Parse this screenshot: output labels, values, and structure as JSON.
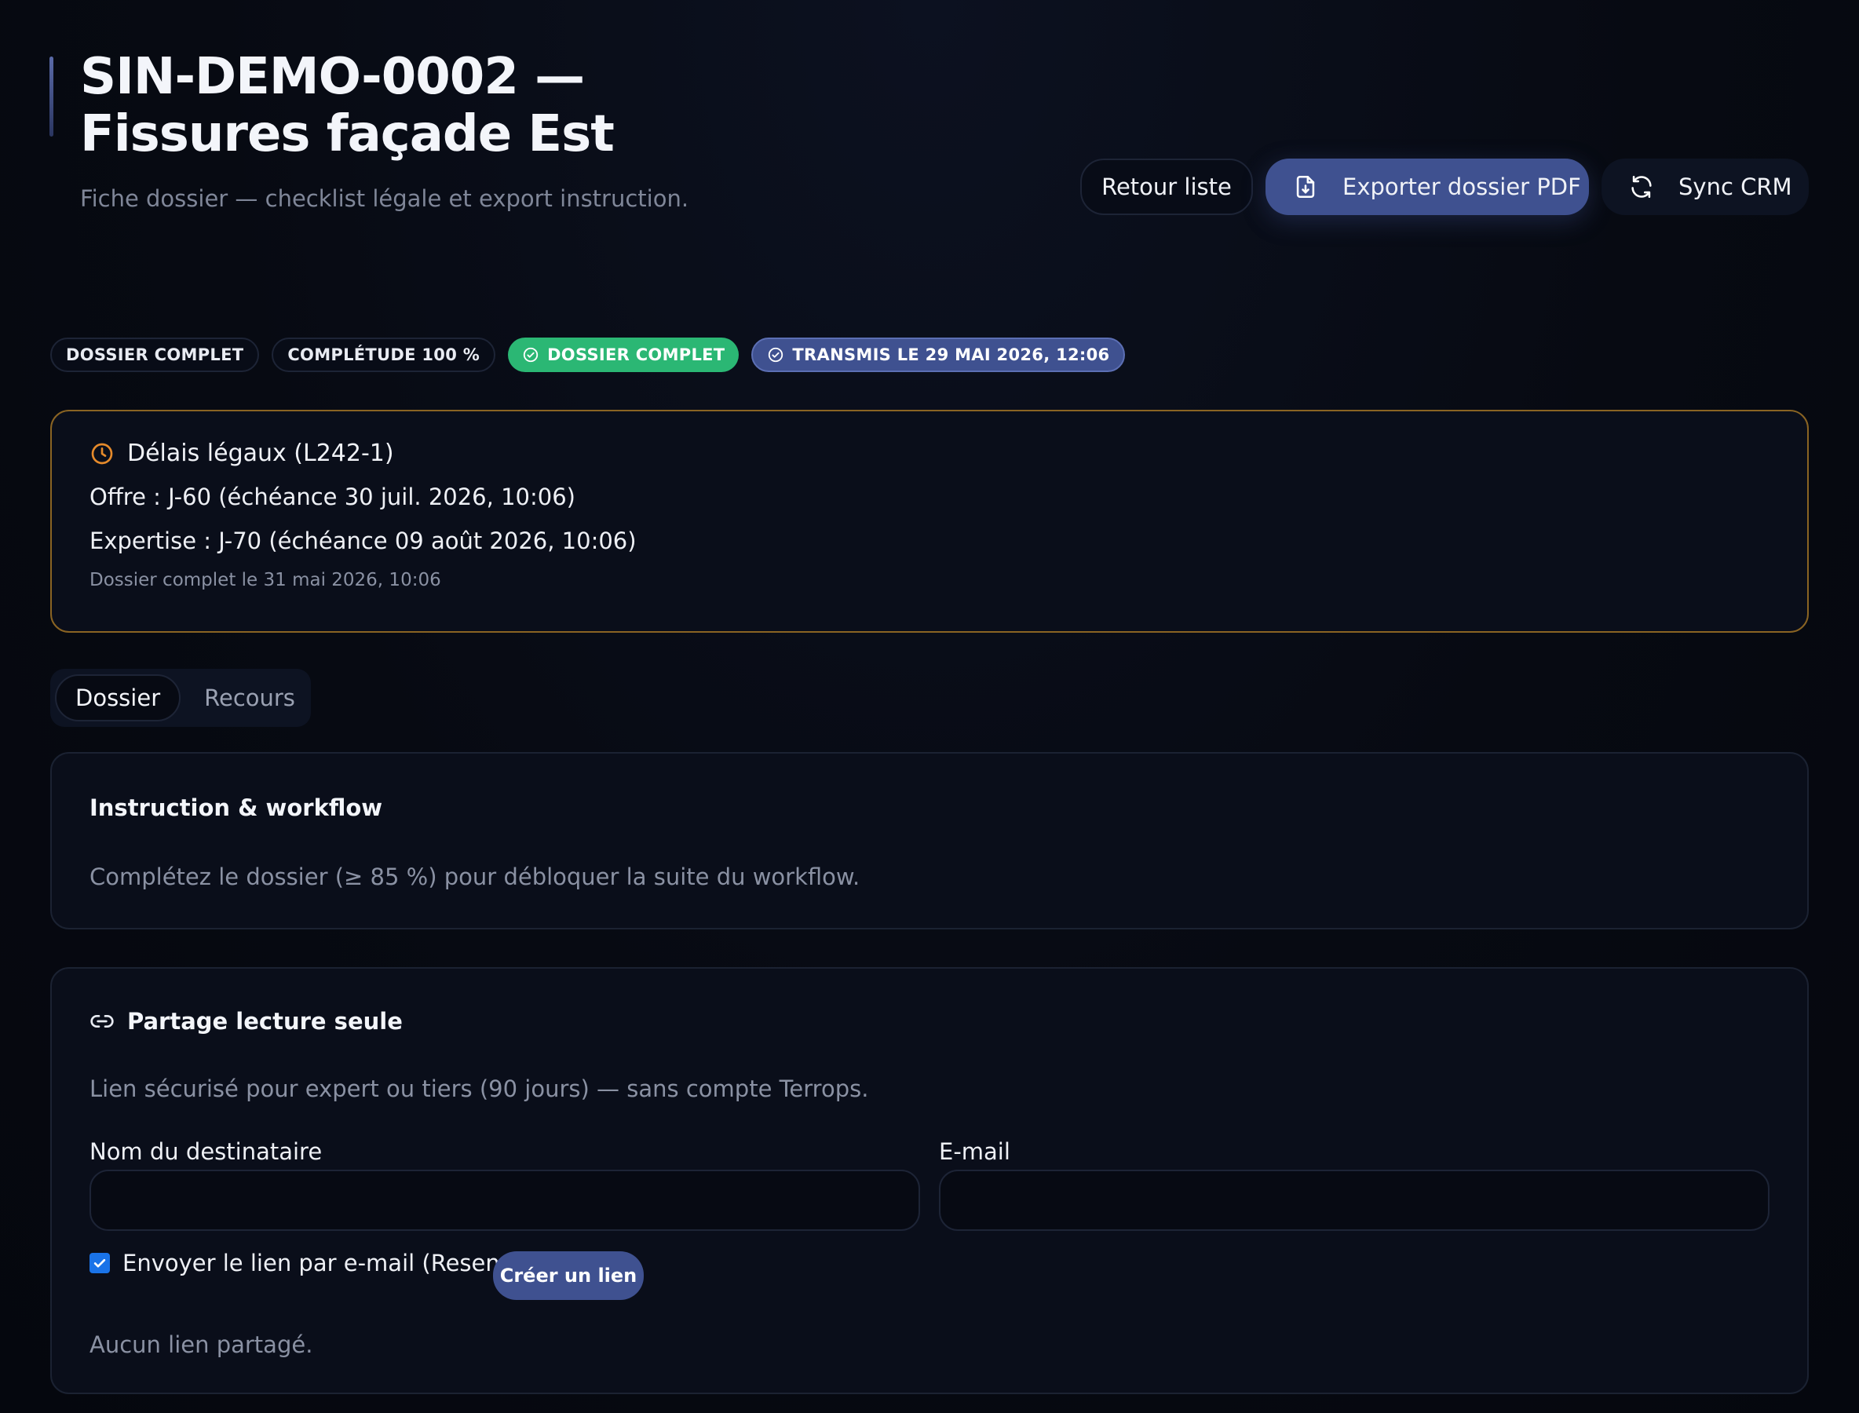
{
  "header": {
    "title_line1": "SIN-DEMO-0002 —",
    "title_line2": "Fissures façade Est",
    "subtitle": "Fiche dossier — checklist légale et export instruction.",
    "back_label": "Retour liste",
    "export_label": "Exporter dossier PDF",
    "sync_label": "Sync CRM"
  },
  "badges": [
    {
      "label": "DOSSIER COMPLET"
    },
    {
      "label": "COMPLÉTUDE 100 %"
    },
    {
      "label": "DOSSIER COMPLET"
    },
    {
      "label": "TRANSMIS LE 29 MAI 2026, 12:06"
    }
  ],
  "deadlines": {
    "title": "Délais légaux (L242-1)",
    "offer": "Offre : J-60 (échéance 30 juil. 2026, 10:06)",
    "expertise": "Expertise : J-70 (échéance 09 août 2026, 10:06)",
    "note": "Dossier complet le 31 mai 2026, 10:06"
  },
  "tabs": [
    {
      "label": "Dossier",
      "active": true
    },
    {
      "label": "Recours",
      "active": false
    }
  ],
  "workflow": {
    "title": "Instruction & workflow",
    "text": "Complétez le dossier (≥ 85 %) pour débloquer la suite du workflow."
  },
  "share": {
    "title": "Partage lecture seule",
    "description": "Lien sécurisé pour expert ou tiers (90 jours) — sans compte Terrops.",
    "recipient_label": "Nom du destinataire",
    "recipient_value": "",
    "email_label": "E-mail",
    "email_value": "",
    "send_email_label": "Envoyer le lien par e-mail (Resend)",
    "send_email_checked": true,
    "create_label": "Créer un lien",
    "empty_text": "Aucun lien partagé."
  },
  "colors": {
    "accent": "#3f5190",
    "success": "#2bb774",
    "warning_border": "#8a6423",
    "clock_icon": "#e58a2b"
  },
  "icons": {
    "export": "file-download-icon",
    "sync": "refresh-icon",
    "badge_check": "check-circle-icon",
    "deadline": "clock-icon",
    "share": "link-icon",
    "checkbox": "checkmark-icon"
  }
}
